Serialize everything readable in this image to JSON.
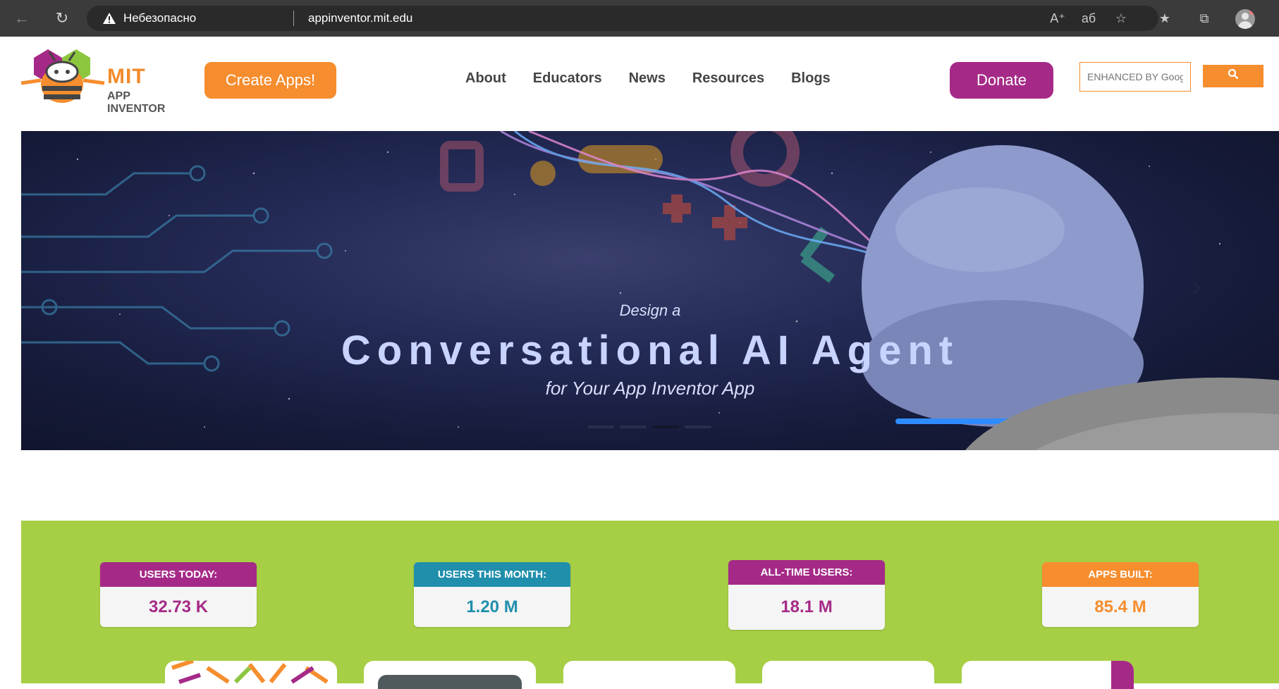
{
  "browser": {
    "security_label": "Небезопасно",
    "url": "appinventor.mit.edu"
  },
  "header": {
    "logo_title": "MIT",
    "logo_subtitle": "APP INVENTOR",
    "create_button": "Create Apps!",
    "nav_items": [
      "About",
      "Educators",
      "News",
      "Resources",
      "Blogs"
    ],
    "donate_button": "Donate",
    "search_placeholder": "ENHANCED BY Google",
    "search_icon": "search-icon"
  },
  "hero": {
    "kicker": "Design a",
    "title": "Conversational AI Agent",
    "subtitle": "for Your App Inventor App",
    "slide_count": 4,
    "active_slide": 3
  },
  "stats": [
    {
      "label": "USERS TODAY:",
      "value": "32.73 K",
      "color": "#a52a87"
    },
    {
      "label": "USERS THIS MONTH:",
      "value": "1.20 M",
      "color": "#1f8fac"
    },
    {
      "label": "ALL-TIME USERS:",
      "value": "18.1 M",
      "color": "#a52a87"
    },
    {
      "label": "APPS BUILT:",
      "value": "85.4 M",
      "color": "#f68d2e"
    }
  ],
  "colors": {
    "accent_orange": "#f68d2e",
    "accent_purple": "#a52a87",
    "stats_green": "#a6cf45"
  }
}
